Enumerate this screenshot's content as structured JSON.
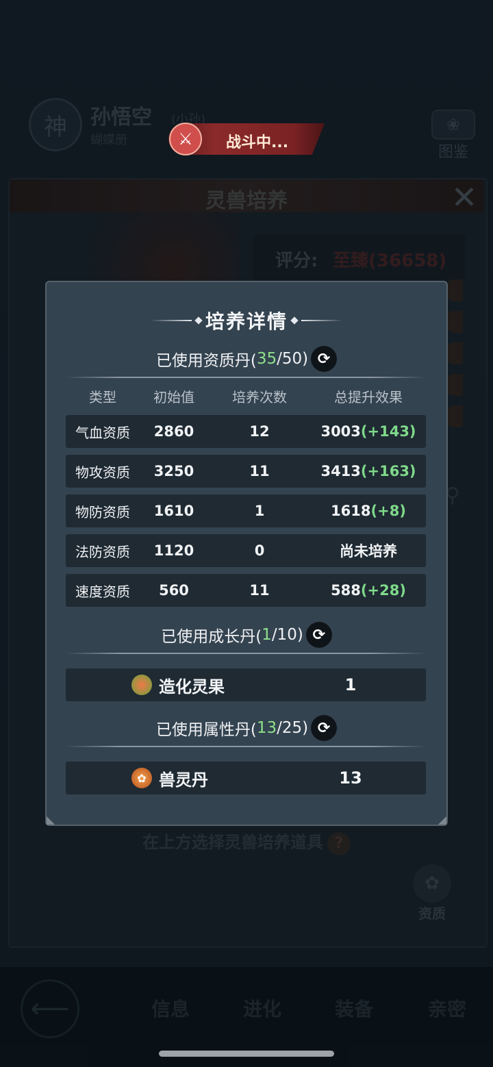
{
  "background": {
    "hero": {
      "badge": "神",
      "name": "孙悟空",
      "tag": "(小孙)",
      "sub": "蝴蝶册"
    },
    "codex_label": "图鉴",
    "battle_status": "战斗中...",
    "panel_title": "灵兽培养",
    "score_label": "评分:",
    "score_value": "至臻(36658)",
    "select_hint": "在上方选择灵兽培养道具",
    "help_icon": "?",
    "aptitude_label": "资质",
    "nav_tabs": [
      "信息",
      "进化",
      "装备",
      "亲密"
    ]
  },
  "modal": {
    "title": "培养详情",
    "aptitude_pill": {
      "prefix": "已使用资质丹(",
      "used": "35",
      "suffix": "/50)"
    },
    "columns": [
      "类型",
      "初始值",
      "培养次数",
      "总提升效果"
    ],
    "rows": [
      {
        "type": "气血资质",
        "initial": "2860",
        "times": "12",
        "total": "3003",
        "bonus": "(+143)"
      },
      {
        "type": "物攻资质",
        "initial": "3250",
        "times": "11",
        "total": "3413",
        "bonus": "(+163)"
      },
      {
        "type": "物防资质",
        "initial": "1610",
        "times": "1",
        "total": "1618",
        "bonus": "(+8)"
      },
      {
        "type": "法防资质",
        "initial": "1120",
        "times": "0",
        "total": "尚未培养",
        "bonus": ""
      },
      {
        "type": "速度资质",
        "initial": "560",
        "times": "11",
        "total": "588",
        "bonus": "(+28)"
      }
    ],
    "growth_pill": {
      "prefix": "已使用成长丹(",
      "used": "1",
      "suffix": "/10)"
    },
    "growth_item": {
      "name": "造化灵果",
      "count": "1",
      "icon": "fruit-icon"
    },
    "attribute_pill": {
      "prefix": "已使用属性丹(",
      "used": "13",
      "suffix": "/25)"
    },
    "attribute_item": {
      "name": "兽灵丹",
      "count": "13",
      "icon": "paw-pill-icon"
    }
  }
}
